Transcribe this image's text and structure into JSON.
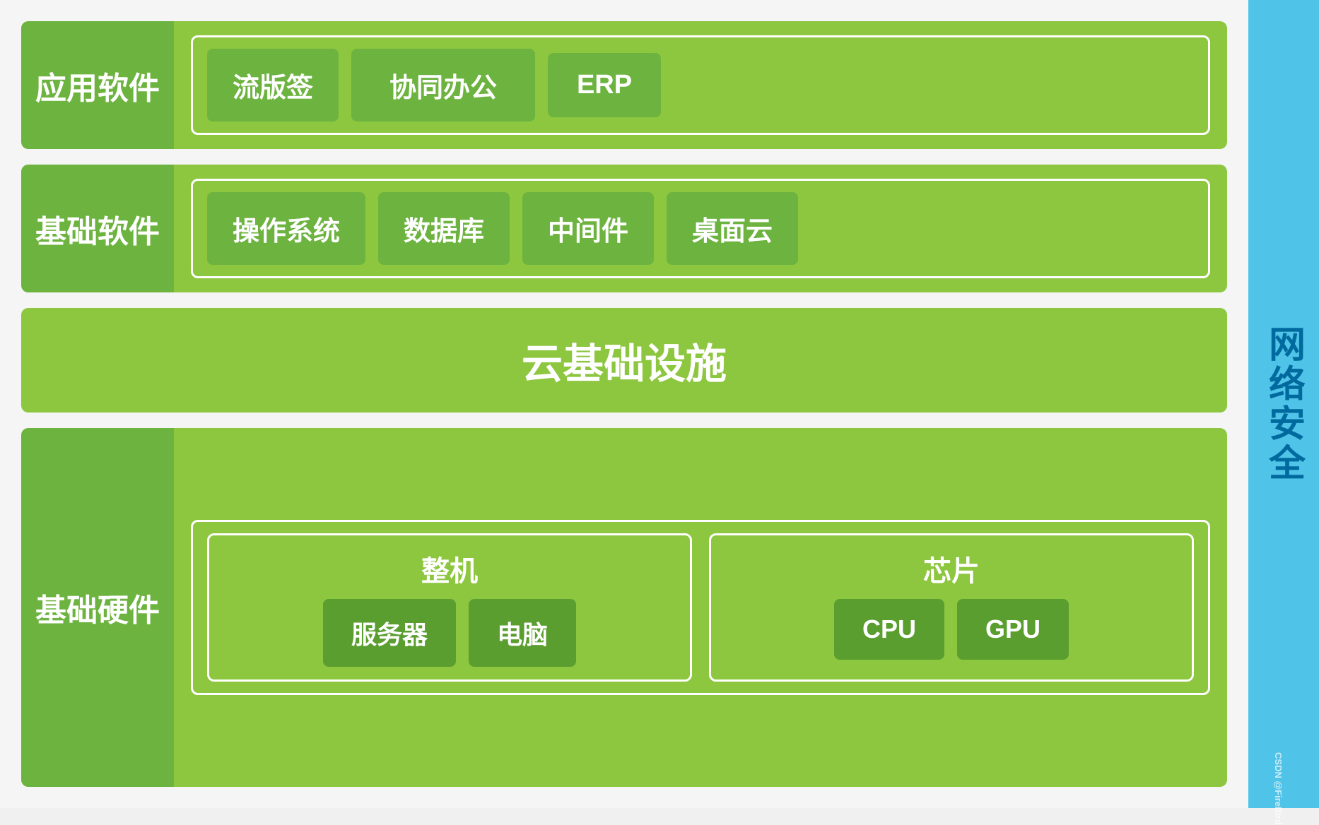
{
  "sidebar": {
    "label": "网络安全",
    "bg_color": "#4fc3e8",
    "text_color": "#006a9e",
    "watermark": "CSDN @FireBird"
  },
  "rows": {
    "app_software": {
      "label": "应用软件",
      "items": [
        "流版签",
        "协同办公",
        "ERP"
      ]
    },
    "base_software": {
      "label": "基础软件",
      "items": [
        "操作系统",
        "数据库",
        "中间件",
        "桌面云"
      ]
    },
    "cloud_infra": {
      "label": "云基础设施"
    },
    "hardware": {
      "label": "基础硬件",
      "groups": [
        {
          "title": "整机",
          "items": [
            "服务器",
            "电脑"
          ]
        },
        {
          "title": "芯片",
          "items": [
            "CPU",
            "GPU"
          ]
        }
      ]
    }
  }
}
